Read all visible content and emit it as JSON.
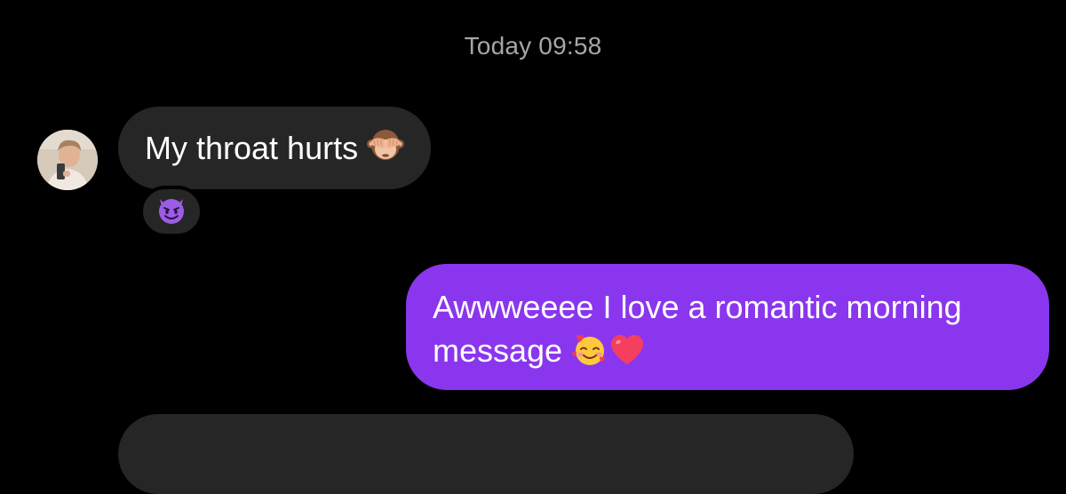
{
  "timestamp": "Today 09:58",
  "incoming": {
    "text": "My throat hurts",
    "emoji": "see-no-evil-monkey-emoji",
    "reaction": "smiling-devil-emoji"
  },
  "outgoing": {
    "line1": "Awwweeee I love a romantic morning",
    "line2": "message",
    "emojis": [
      "smiling-face-with-hearts-emoji",
      "red-heart-emoji"
    ],
    "bubble_color": "#8a36ee"
  },
  "colors": {
    "background": "#000000",
    "incoming_bubble": "#262626",
    "timestamp_text": "#a6a6a6"
  }
}
